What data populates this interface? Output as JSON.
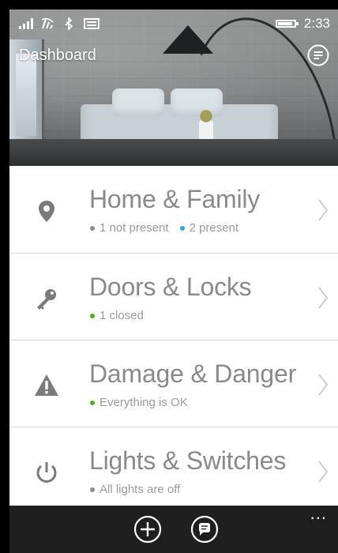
{
  "status_bar": {
    "time": "2:33",
    "icons": [
      "signal-icon",
      "wifi-icon",
      "bluetooth-icon",
      "message-icon",
      "battery-icon"
    ]
  },
  "header": {
    "title": "Dashboard",
    "notes_icon": "notes-icon"
  },
  "list": [
    {
      "title": "Home & Family",
      "icon": "location-pin-icon",
      "status": [
        {
          "text": "1 not present",
          "color": "#8c8c8c"
        },
        {
          "text": "2 present",
          "color": "#3aa3d6"
        }
      ]
    },
    {
      "title": "Doors & Locks",
      "icon": "key-icon",
      "status": [
        {
          "text": "1 closed",
          "color": "#4caf1c"
        }
      ]
    },
    {
      "title": "Damage & Danger",
      "icon": "warning-icon",
      "status": [
        {
          "text": "Everything is OK",
          "color": "#4caf1c"
        }
      ]
    },
    {
      "title": "Lights & Switches",
      "icon": "power-icon",
      "status": [
        {
          "text": "All lights are off",
          "color": "#8c8c8c"
        }
      ]
    }
  ],
  "app_bar": {
    "buttons": [
      {
        "icon": "add-icon"
      },
      {
        "icon": "chat-icon"
      }
    ],
    "more": "..."
  },
  "colors": {
    "text_gray": "#8a8a8a",
    "divider": "#d6d6d6",
    "app_bar_bg": "#1f1f1f",
    "status_blue": "#3aa3d6",
    "status_green": "#4caf1c",
    "status_gray": "#8c8c8c"
  }
}
